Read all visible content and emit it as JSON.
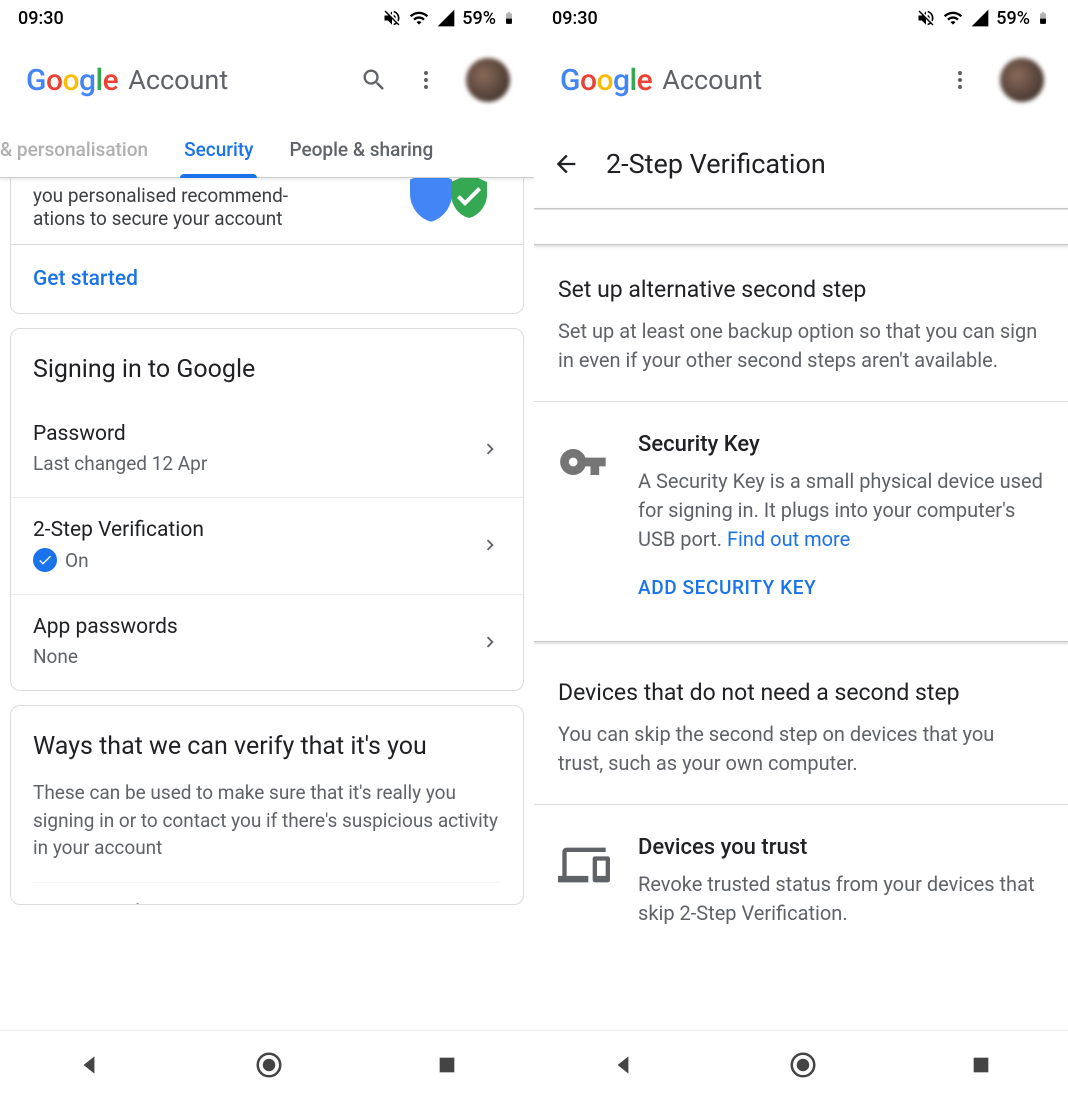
{
  "status": {
    "time": "09:30",
    "battery_text": "59%"
  },
  "header": {
    "brand": "Google",
    "product": "Account"
  },
  "left": {
    "tabs": {
      "prev": "& personalisation",
      "active": "Security",
      "next": "People & sharing"
    },
    "recommend_text": "you personalised recommend-\nations to secure your account",
    "get_started": "Get started",
    "signing_in_title": "Signing in to Google",
    "items": [
      {
        "title": "Password",
        "sub": "Last changed 12 Apr"
      },
      {
        "title": "2-Step Verification",
        "sub": "On"
      },
      {
        "title": "App passwords",
        "sub": "None"
      }
    ],
    "verify_title": "Ways that we can verify that it's you",
    "verify_desc": "These can be used to make sure that it's really you signing in or to contact you if there's suspicious activity in your account",
    "recovery_phone_label": "Recovery phone"
  },
  "right": {
    "page_title": "2-Step Verification",
    "alt_title": "Set up alternative second step",
    "alt_desc": "Set up at least one backup option so that you can sign in even if your other second steps aren't available.",
    "key_title": "Security Key",
    "key_desc": "A Security Key is a small physical device used for signing in. It plugs into your computer's USB port. ",
    "find_out_more": "Find out more",
    "add_key": "ADD SECURITY KEY",
    "devices_title": "Devices that do not need a second step",
    "devices_desc": "You can skip the second step on devices that you trust, such as your own computer.",
    "trust_title": "Devices you trust",
    "trust_desc": "Revoke trusted status from your devices that skip 2-Step Verification."
  }
}
